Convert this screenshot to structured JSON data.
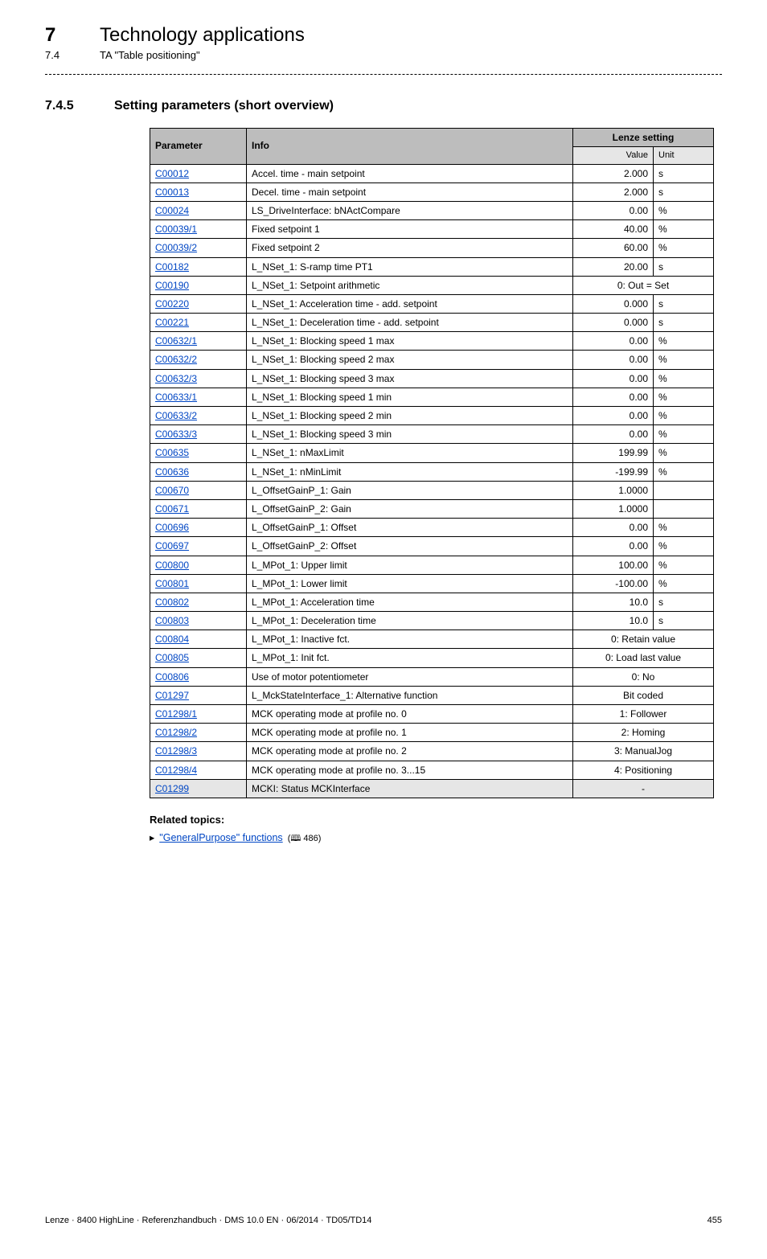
{
  "header": {
    "chapter_num": "7",
    "chapter_title": "Technology applications",
    "sub_num": "7.4",
    "sub_title": "TA \"Table positioning\""
  },
  "section": {
    "num": "7.4.5",
    "title": "Setting parameters (short overview)"
  },
  "table": {
    "head": {
      "parameter": "Parameter",
      "info": "Info",
      "lenze": "Lenze setting",
      "value": "Value",
      "unit": "Unit"
    },
    "rows": [
      {
        "param": "C00012",
        "info": "Accel. time - main setpoint",
        "value": "2.000",
        "unit": "s",
        "span": false
      },
      {
        "param": "C00013",
        "info": "Decel. time - main setpoint",
        "value": "2.000",
        "unit": "s",
        "span": false
      },
      {
        "param": "C00024",
        "info": "LS_DriveInterface: bNActCompare",
        "value": "0.00",
        "unit": "%",
        "span": false
      },
      {
        "param": "C00039/1",
        "info": "Fixed setpoint 1",
        "value": "40.00",
        "unit": "%",
        "span": false
      },
      {
        "param": "C00039/2",
        "info": "Fixed setpoint 2",
        "value": "60.00",
        "unit": "%",
        "span": false
      },
      {
        "param": "C00182",
        "info": "L_NSet_1: S-ramp time PT1",
        "value": "20.00",
        "unit": "s",
        "span": false
      },
      {
        "param": "C00190",
        "info": "L_NSet_1: Setpoint arithmetic",
        "value": "0: Out = Set",
        "unit": "",
        "span": true
      },
      {
        "param": "C00220",
        "info": "L_NSet_1: Acceleration time - add. setpoint",
        "value": "0.000",
        "unit": "s",
        "span": false
      },
      {
        "param": "C00221",
        "info": "L_NSet_1: Deceleration time - add. setpoint",
        "value": "0.000",
        "unit": "s",
        "span": false
      },
      {
        "param": "C00632/1",
        "info": "L_NSet_1: Blocking speed 1 max",
        "value": "0.00",
        "unit": "%",
        "span": false
      },
      {
        "param": "C00632/2",
        "info": "L_NSet_1: Blocking speed 2 max",
        "value": "0.00",
        "unit": "%",
        "span": false
      },
      {
        "param": "C00632/3",
        "info": "L_NSet_1: Blocking speed 3 max",
        "value": "0.00",
        "unit": "%",
        "span": false
      },
      {
        "param": "C00633/1",
        "info": "L_NSet_1: Blocking speed 1 min",
        "value": "0.00",
        "unit": "%",
        "span": false
      },
      {
        "param": "C00633/2",
        "info": "L_NSet_1: Blocking speed 2 min",
        "value": "0.00",
        "unit": "%",
        "span": false
      },
      {
        "param": "C00633/3",
        "info": "L_NSet_1: Blocking speed 3 min",
        "value": "0.00",
        "unit": "%",
        "span": false
      },
      {
        "param": "C00635",
        "info": "L_NSet_1: nMaxLimit",
        "value": "199.99",
        "unit": "%",
        "span": false
      },
      {
        "param": "C00636",
        "info": "L_NSet_1: nMinLimit",
        "value": "-199.99",
        "unit": "%",
        "span": false
      },
      {
        "param": "C00670",
        "info": "L_OffsetGainP_1: Gain",
        "value": "1.0000",
        "unit": "",
        "span": false
      },
      {
        "param": "C00671",
        "info": "L_OffsetGainP_2: Gain",
        "value": "1.0000",
        "unit": "",
        "span": false
      },
      {
        "param": "C00696",
        "info": "L_OffsetGainP_1: Offset",
        "value": "0.00",
        "unit": "%",
        "span": false
      },
      {
        "param": "C00697",
        "info": "L_OffsetGainP_2: Offset",
        "value": "0.00",
        "unit": "%",
        "span": false
      },
      {
        "param": "C00800",
        "info": "L_MPot_1: Upper limit",
        "value": "100.00",
        "unit": "%",
        "span": false
      },
      {
        "param": "C00801",
        "info": "L_MPot_1: Lower limit",
        "value": "-100.00",
        "unit": "%",
        "span": false
      },
      {
        "param": "C00802",
        "info": "L_MPot_1: Acceleration time",
        "value": "10.0",
        "unit": "s",
        "span": false
      },
      {
        "param": "C00803",
        "info": "L_MPot_1: Deceleration time",
        "value": "10.0",
        "unit": "s",
        "span": false
      },
      {
        "param": "C00804",
        "info": "L_MPot_1: Inactive fct.",
        "value": "0: Retain value",
        "unit": "",
        "span": true
      },
      {
        "param": "C00805",
        "info": "L_MPot_1: Init fct.",
        "value": "0: Load last value",
        "unit": "",
        "span": true
      },
      {
        "param": "C00806",
        "info": "Use of motor potentiometer",
        "value": "0: No",
        "unit": "",
        "span": true
      },
      {
        "param": "C01297",
        "info": "L_MckStateInterface_1: Alternative function",
        "value": "Bit coded",
        "unit": "",
        "span": true
      },
      {
        "param": "C01298/1",
        "info": "MCK operating mode at profile no. 0",
        "value": "1: Follower",
        "unit": "",
        "span": true
      },
      {
        "param": "C01298/2",
        "info": "MCK operating mode at profile no. 1",
        "value": "2: Homing",
        "unit": "",
        "span": true
      },
      {
        "param": "C01298/3",
        "info": "MCK operating mode at profile no. 2",
        "value": "3: ManualJog",
        "unit": "",
        "span": true
      },
      {
        "param": "C01298/4",
        "info": "MCK operating mode at profile no. 3...15",
        "value": "4: Positioning",
        "unit": "",
        "span": true
      },
      {
        "param": "C01299",
        "info": "MCKI: Status MCKInterface",
        "value": "-",
        "unit": "",
        "span": true,
        "shade": true
      }
    ]
  },
  "related": {
    "heading": "Related topics:",
    "arrow": "▸",
    "link_text": "\"GeneralPurpose\" functions",
    "page_ref": "486"
  },
  "footer": {
    "left": "Lenze · 8400 HighLine · Referenzhandbuch · DMS 10.0 EN · 06/2014 · TD05/TD14",
    "right": "455"
  }
}
